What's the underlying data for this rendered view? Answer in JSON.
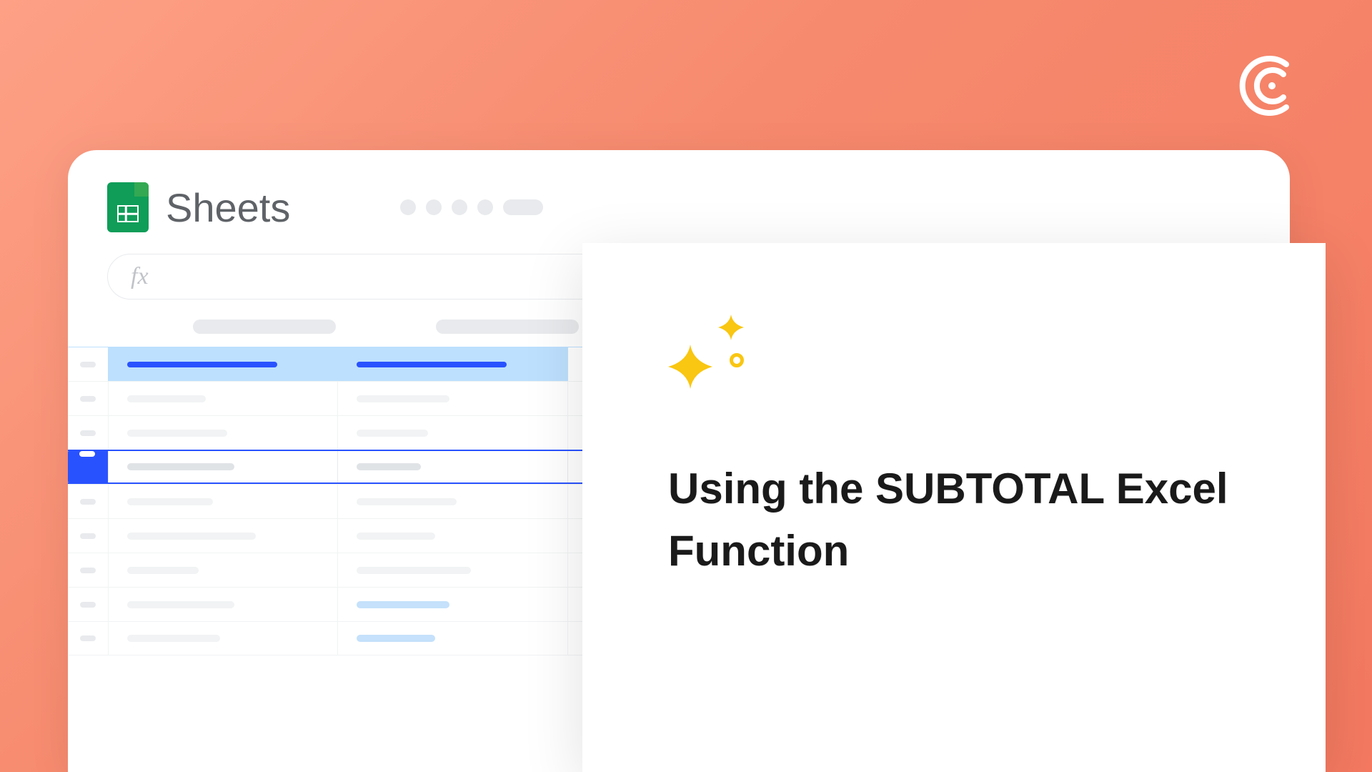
{
  "corner_logo": "brand-logo",
  "sheets": {
    "app_name": "Sheets",
    "fx_label": "fx"
  },
  "card": {
    "title": "Using the SUBTOTAL Excel Function"
  }
}
